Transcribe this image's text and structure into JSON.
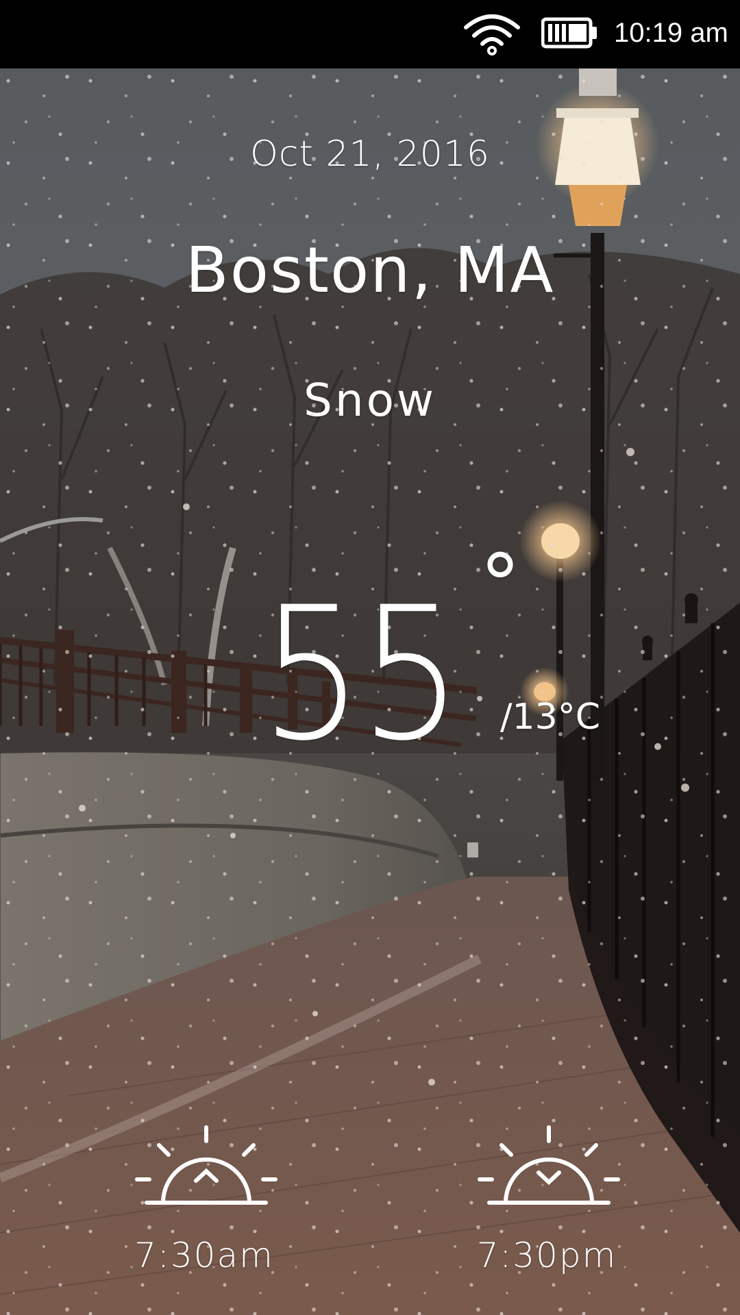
{
  "status_bar": {
    "time": "10:19 am",
    "wifi_icon": "wifi-icon",
    "battery_icon": "battery-icon"
  },
  "weather": {
    "date": "Oct 21, 2016",
    "location": "Boston, MA",
    "condition": "Snow",
    "temperature": "55",
    "degree_symbol": "°",
    "temperature_celsius": "/13°C",
    "sunrise_time": "7:30am",
    "sunset_time": "7:30pm",
    "sunrise_icon": "sunrise-icon",
    "sunset_icon": "sunset-icon"
  },
  "colors": {
    "status_bar_bg": "#000000",
    "text": "#ffffff",
    "sky": "#5a5f63",
    "lamp_glow": "#f3d3a6",
    "brick_path": "#6e5246"
  }
}
